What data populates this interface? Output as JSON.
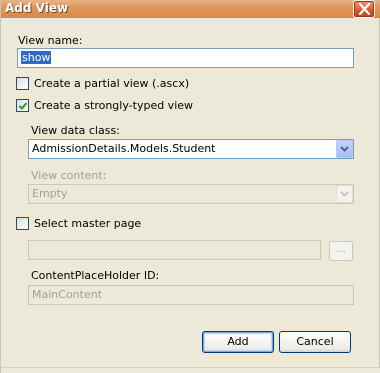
{
  "window": {
    "title": "Add View"
  },
  "form": {
    "view_name_label": "View name:",
    "view_name_value": "show",
    "partial_view": {
      "label": "Create a partial view (.ascx)",
      "checked": false
    },
    "strongly_typed": {
      "label": "Create a strongly-typed view",
      "checked": true
    },
    "view_data_class_label": "View data class:",
    "view_data_class_value": "AdmissionDetails.Models.Student",
    "view_content_label": "View content:",
    "view_content_value": "Empty",
    "master_page": {
      "label": "Select master page",
      "checked": false
    },
    "master_page_path": "",
    "browse_label": "...",
    "content_placeholder_label": "ContentPlaceHolder ID:",
    "content_placeholder_value": "MainContent"
  },
  "buttons": {
    "add": "Add",
    "cancel": "Cancel"
  },
  "icons": {
    "close": "close-icon",
    "check": "checkmark-icon",
    "dropdown": "chevron-down-icon"
  },
  "colors": {
    "titlebar": "#e0955a",
    "dialog_bg": "#ece9d8",
    "selection": "#316ac5",
    "textbox_border": "#7f9db9"
  }
}
